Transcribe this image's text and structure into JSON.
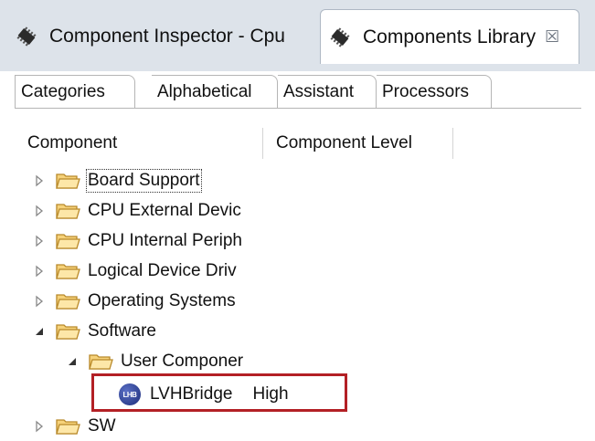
{
  "view_tabs": [
    {
      "label": "Component Inspector - Cpu",
      "icon": "chip-icon",
      "active": false
    },
    {
      "label": "Components Library",
      "icon": "chip-icon",
      "active": true,
      "close_glyph": "☒"
    }
  ],
  "sub_tabs": [
    "Categories",
    "Alphabetical",
    "Assistant",
    "Processors"
  ],
  "columns": [
    "Component",
    "Component Level"
  ],
  "tree": [
    {
      "label": "Board Support",
      "expanded": false
    },
    {
      "label": "CPU External Devic",
      "expanded": false
    },
    {
      "label": "CPU Internal Periph",
      "expanded": false
    },
    {
      "label": "Logical Device Driv",
      "expanded": false
    },
    {
      "label": "Operating Systems",
      "expanded": false
    },
    {
      "label": "Software",
      "expanded": true
    },
    {
      "label": "User Componer",
      "expanded": true
    },
    {
      "label": "LVHBridge",
      "level": "High",
      "icon_text": "LHB"
    },
    {
      "label": "SW",
      "expanded": false
    }
  ],
  "colors": {
    "highlight": "#b32025",
    "tabbar_bg": "#dde3ea"
  }
}
